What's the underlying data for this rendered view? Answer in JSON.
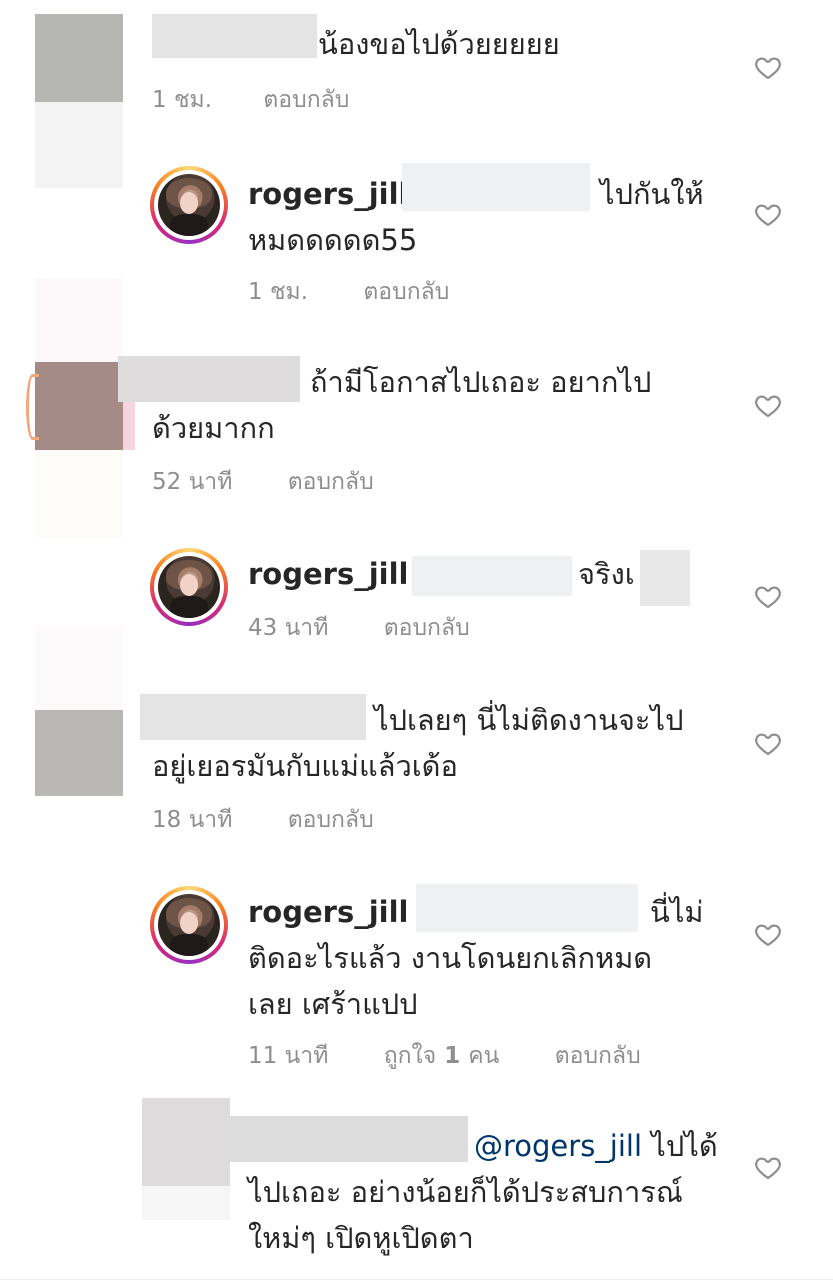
{
  "comments": [
    {
      "text": "น้องขอไปด้วยยยยย",
      "time": "1 ชม.",
      "reply_label": "ตอบกลับ"
    },
    {
      "username": "rogers_jill",
      "mention_prefix": "(",
      "line1_tail": "ไปกันให้",
      "line2": "หมดดดดด55",
      "time": "1 ชม.",
      "reply_label": "ตอบกลับ"
    },
    {
      "line1": "ถ้ามีโอกาสไปเถอะ อยากไป",
      "line2": "ด้วยมากก",
      "time": "52 นาที",
      "reply_label": "ตอบกลับ"
    },
    {
      "username": "rogers_jill",
      "mention_prefix": "(",
      "line1_tail": "จริงเ",
      "time": "43 นาที",
      "reply_label": "ตอบกลับ"
    },
    {
      "line1": "ไปเลยๆ นี่ไม่ติดงานจะไป",
      "line2": "อยู่เยอรมันกับแม่แล้วเด้อ",
      "time": "18 นาที",
      "reply_label": "ตอบกลับ"
    },
    {
      "username": "rogers_jill",
      "mention_prefix": "@",
      "line1_tail": "นี่ไม่",
      "line2": "ติดอะไรแล้ว งานโดนยกเลิกหมด",
      "line3": "เลย เศร้าแปป",
      "time": "11 นาที",
      "likes_prefix": "ถูกใจ",
      "likes_count": "1",
      "likes_suffix": "คน",
      "reply_label": "ตอบกลับ"
    },
    {
      "mention": "@rogers_jill",
      "line1_tail": "ไปได้",
      "line2": "ไปเถอะ อย่างน้อยก็ได้ประสบการณ์",
      "line3": "ใหม่ๆ เปิดหูเปิดตา"
    }
  ],
  "icons": {
    "like": "heart-outline-icon"
  },
  "colors": {
    "text": "#262626",
    "meta": "#8e8e8e",
    "mention": "#003569"
  }
}
